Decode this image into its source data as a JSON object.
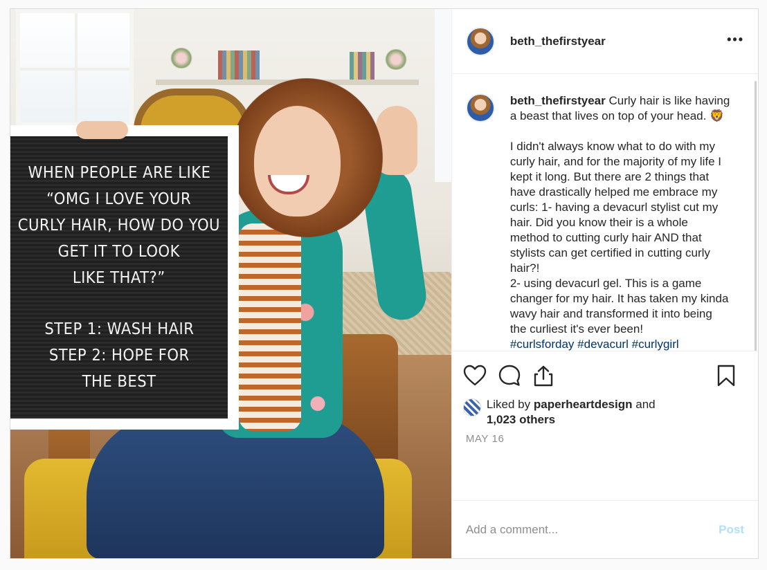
{
  "post": {
    "photo": {
      "letterboard_lines": [
        "WHEN PEOPLE ARE LIKE",
        "“OMG I LOVE YOUR",
        "CURLY HAIR, HOW DO YOU",
        "GET IT TO LOOK",
        "LIKE THAT?”",
        "",
        "STEP 1: WASH HAIR",
        "STEP 2: HOPE FOR",
        "THE BEST"
      ]
    },
    "header": {
      "username": "beth_thefirstyear",
      "more_icon": "more-horizontal-icon"
    },
    "caption": {
      "username": "beth_thefirstyear",
      "line1": "Curly hair is like having a beast that lives on top of your head. 🦁",
      "paragraph2": "I didn't always know what to do with my curly hair, and for the majority of my life I kept it long. But there are 2 things that have drastically helped me embrace my curls: 1- having a devacurl stylist cut my hair. Did you know their is a whole method to cutting curly hair AND that stylists can get certified in cutting curly hair?!",
      "paragraph3": "2- using devacurl gel. This is a game changer for my hair. It has taken my kinda wavy hair and transformed it into being the curliest it's ever been!",
      "hashtags": [
        "#curlsforday",
        "#devacurl",
        "#curlygirl"
      ]
    },
    "actions": {
      "icons": [
        "heart-icon",
        "comment-icon",
        "share-icon",
        "bookmark-icon"
      ]
    },
    "likes": {
      "prefix": "Liked by ",
      "user": "paperheartdesign",
      "middle": " and",
      "others": "1,023 others"
    },
    "date": "MAY 16",
    "comment_box": {
      "placeholder": "Add a comment...",
      "post_label": "Post",
      "post_color": "#b2dffc"
    },
    "colors": {
      "link": "#003569",
      "meta": "#8e8e8e",
      "border": "#dbdbdb"
    }
  }
}
